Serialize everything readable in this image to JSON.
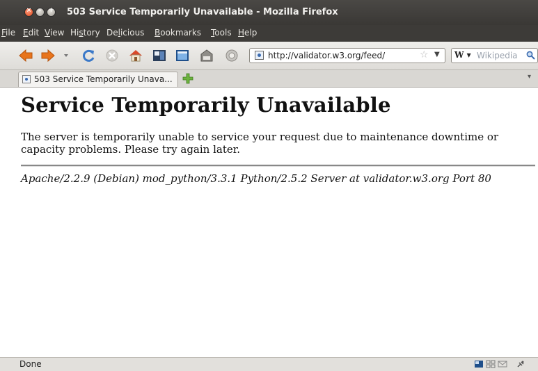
{
  "window": {
    "title": "503 Service Temporarily Unavailable - Mozilla Firefox",
    "controls": {
      "close": "×",
      "minimize": "–",
      "maximize": "+"
    }
  },
  "menu": {
    "items": [
      {
        "label": "File",
        "accel": "F",
        "rest": "ile"
      },
      {
        "label": "Edit",
        "accel": "E",
        "rest": "dit"
      },
      {
        "label": "View",
        "accel": "V",
        "rest": "iew"
      },
      {
        "label": "History",
        "pre": "Hi",
        "accel": "s",
        "rest": "tory"
      },
      {
        "label": "Delicious",
        "pre": "De",
        "accel": "l",
        "rest": "icious"
      },
      {
        "label": "Bookmarks",
        "accel": "B",
        "rest": "ookmarks"
      },
      {
        "label": "Tools",
        "accel": "T",
        "rest": "ools"
      },
      {
        "label": "Help",
        "accel": "H",
        "rest": "elp"
      }
    ]
  },
  "navigation": {
    "icons": [
      "back-icon",
      "forward-icon",
      "history-dropdown-icon",
      "reload-icon",
      "stop-icon",
      "home-icon",
      "bookmark-icon",
      "screen-icon",
      "tag-icon",
      "settings-icon"
    ],
    "url": "http://validator.w3.org/feed/",
    "star": "☆",
    "dropdown": "▼",
    "search": {
      "engine": "W ▾",
      "placeholder": "Wikipedia"
    }
  },
  "tabs": {
    "items": [
      {
        "label": "503 Service Temporarily Unava..."
      }
    ],
    "list_arrow": "▾"
  },
  "page": {
    "heading": "Service Temporarily Unavailable",
    "message": "The server is temporarily unable to service your request due to maintenance downtime or capacity problems. Please try again later.",
    "address": "Apache/2.2.9 (Debian) mod_python/3.3.1 Python/2.5.2 Server at validator.w3.org Port 80"
  },
  "status": {
    "text": "Done",
    "icons": [
      "screen-status-icon",
      "grid-status-icon",
      "mail-status-icon",
      "plugin-status-icon"
    ]
  },
  "colors": {
    "titlebar": "#3a3835",
    "back_arrow": "#e8741c",
    "reload": "#3b79c8",
    "new_tab": "#6db33f"
  }
}
